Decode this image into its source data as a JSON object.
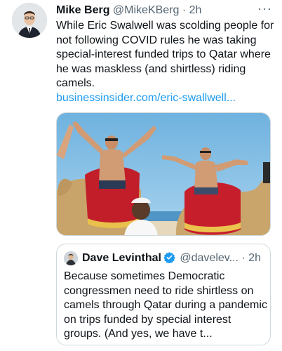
{
  "tweet": {
    "author_name": "Mike Berg",
    "author_handle": "@MikeKBerg",
    "separator": "·",
    "time": "2h",
    "more_label": "···",
    "text": "While Eric Swalwell was scolding people for not following COVID rules he was taking special-interest funded trips to Qatar where he was maskless (and shirtless) riding camels.",
    "link": "businessinsider.com/eric-swallwell..."
  },
  "quote": {
    "author_name": "Dave Levinthal",
    "author_handle": "@davelev...",
    "separator": "·",
    "time": "2h",
    "text": "Because sometimes Democratic congressmen need to ride shirtless on camels through Qatar during a pandemic on trips funded by special interest groups. (And yes, we have t..."
  },
  "colors": {
    "link": "#1d9bf0",
    "secondary_text": "#536471",
    "border": "#cfd9de",
    "verified": "#1d9bf0"
  },
  "icons": {
    "more": "more-icon",
    "verified": "verified-badge-icon"
  }
}
